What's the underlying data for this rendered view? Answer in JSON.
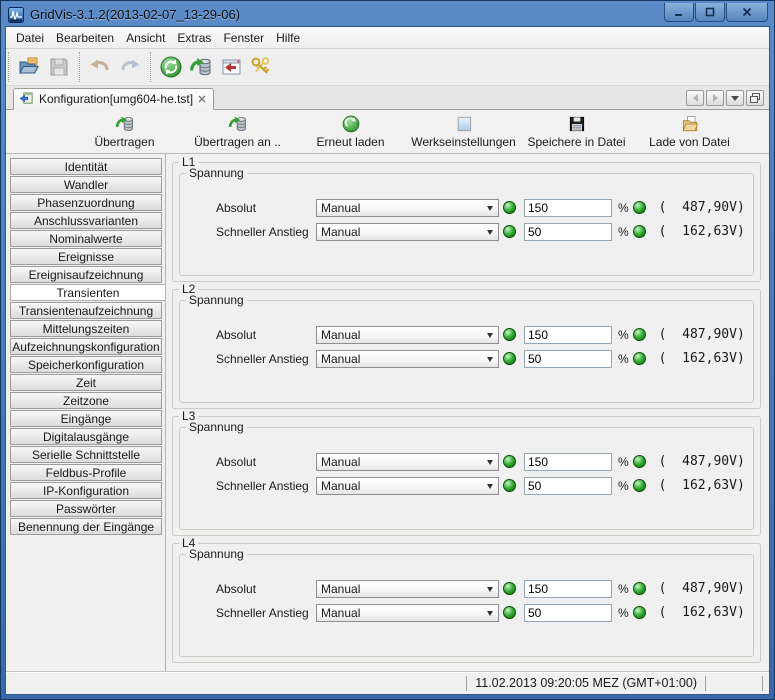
{
  "window": {
    "title": "GridVis-3.1.2(2013-02-07_13-29-06)"
  },
  "menu": {
    "items": [
      "Datei",
      "Bearbeiten",
      "Ansicht",
      "Extras",
      "Fenster",
      "Hilfe"
    ]
  },
  "main_toolbar": {
    "icons": [
      "open-file",
      "save (disabled)",
      "undo (disabled)",
      "redo (disabled)",
      "sync-device",
      "transfer-database",
      "import-window",
      "connection-keys"
    ]
  },
  "tab": {
    "label": "Konfiguration[umg604-he.tst]",
    "close_icon": "close-tab"
  },
  "tab_controls": {
    "icons": [
      "scroll-tabs-left",
      "scroll-tabs-right",
      "tab-list-dropdown",
      "maximize-view"
    ]
  },
  "actionbar": {
    "buttons": [
      {
        "label": "Übertragen",
        "icon": "database-upload-icon"
      },
      {
        "label": "Übertragen an ..",
        "icon": "database-upload-icon"
      },
      {
        "label": "Erneut laden",
        "icon": "reload-icon"
      },
      {
        "label": "Werkseinstellungen",
        "icon": "factory-settings-icon"
      },
      {
        "label": "Speichere in Datei",
        "icon": "save-to-file-icon"
      },
      {
        "label": "Lade von Datei",
        "icon": "load-from-file-icon"
      }
    ]
  },
  "sidebar": {
    "selected": "Transienten",
    "items": [
      "Identität",
      "Wandler",
      "Phasenzuordnung",
      "Anschlussvarianten",
      "Nominalwerte",
      "Ereignisse",
      "Ereignisaufzeichnung",
      "Transienten",
      "Transientenaufzeichnung",
      "Mittelungszeiten",
      "Aufzeichnungskonfiguration",
      "Speicherkonfiguration",
      "Zeit",
      "Zeitzone",
      "Eingänge",
      "Digitalausgänge",
      "Serielle Schnittstelle",
      "Feldbus-Profile",
      "IP-Konfiguration",
      "Passwörter",
      "Benennung der Eingänge"
    ]
  },
  "panels": [
    {
      "id": "L1",
      "group": "Spannung",
      "rows": [
        {
          "label": "Absolut",
          "mode": "Manual",
          "value": "150",
          "unit": "%",
          "computed": "(  487,90V)"
        },
        {
          "label": "Schneller Anstieg",
          "mode": "Manual",
          "value": "50",
          "unit": "%",
          "computed": "(  162,63V)"
        }
      ]
    },
    {
      "id": "L2",
      "group": "Spannung",
      "rows": [
        {
          "label": "Absolut",
          "mode": "Manual",
          "value": "150",
          "unit": "%",
          "computed": "(  487,90V)"
        },
        {
          "label": "Schneller Anstieg",
          "mode": "Manual",
          "value": "50",
          "unit": "%",
          "computed": "(  162,63V)"
        }
      ]
    },
    {
      "id": "L3",
      "group": "Spannung",
      "rows": [
        {
          "label": "Absolut",
          "mode": "Manual",
          "value": "150",
          "unit": "%",
          "computed": "(  487,90V)"
        },
        {
          "label": "Schneller Anstieg",
          "mode": "Manual",
          "value": "50",
          "unit": "%",
          "computed": "(  162,63V)"
        }
      ]
    },
    {
      "id": "L4",
      "group": "Spannung",
      "rows": [
        {
          "label": "Absolut",
          "mode": "Manual",
          "value": "150",
          "unit": "%",
          "computed": "(  487,90V)"
        },
        {
          "label": "Schneller Anstieg",
          "mode": "Manual",
          "value": "50",
          "unit": "%",
          "computed": "(  162,63V)"
        }
      ]
    }
  ],
  "statusbar": {
    "datetime": "11.02.2013 09:20:05 MEZ (GMT+01:00)"
  },
  "colors": {
    "titlebar_blue": "#4a80c4",
    "led_green": "#1f9a1f",
    "factory_icon_blue": "#a7cdea"
  }
}
